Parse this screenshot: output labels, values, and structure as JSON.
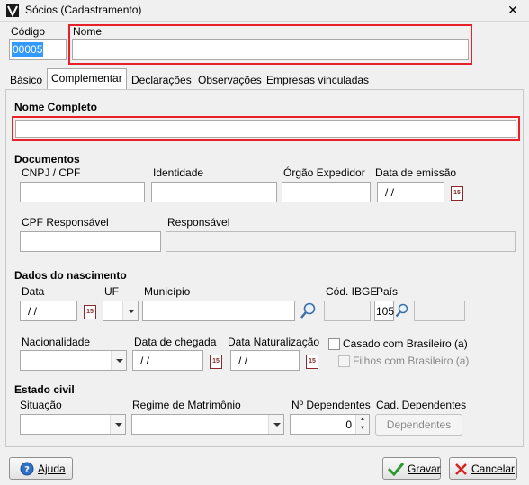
{
  "window": {
    "title": "Sócios (Cadastramento)",
    "close_glyph": "✕"
  },
  "header": {
    "codigo_label": "Código",
    "codigo_value": "00005",
    "nome_label": "Nome",
    "nome_value": ""
  },
  "tabs": [
    {
      "label": "Básico",
      "active": false
    },
    {
      "label": "Complementar",
      "active": true
    },
    {
      "label": "Declarações",
      "active": false
    },
    {
      "label": "Observações",
      "active": false
    },
    {
      "label": "Empresas vinculadas",
      "active": false
    }
  ],
  "nome_completo": {
    "label": "Nome Completo",
    "value": ""
  },
  "documentos": {
    "section_label": "Documentos",
    "cnpj_cpf_label": "CNPJ / CPF",
    "identidade_label": "Identidade",
    "orgao_label": "Órgão Expedidor",
    "data_emissao_label": "Data de emissão",
    "data_emissao_value": " /  /",
    "cpf_responsavel_label": "CPF Responsável",
    "responsavel_label": "Responsável"
  },
  "nascimento": {
    "section_label": "Dados do nascimento",
    "data_label": "Data",
    "data_value": " /  /",
    "uf_label": "UF",
    "municipio_label": "Município",
    "cod_ibge_label": "Cód. IBGE",
    "pais_label": "País",
    "pais_value": "105",
    "nacionalidade_label": "Nacionalidade",
    "data_chegada_label": "Data de chegada",
    "data_chegada_value": " /  /",
    "data_naturalizacao_label": "Data Naturalização",
    "data_naturalizacao_value": " /  /",
    "casado_label": "Casado com Brasileiro (a)",
    "filhos_label": "Filhos com Brasileiro (a)"
  },
  "estado_civil": {
    "section_label": "Estado civil",
    "situacao_label": "Situação",
    "regime_label": "Regime de Matrimônio",
    "n_dependentes_label": "Nº Dependentes",
    "n_dependentes_value": "0",
    "cad_dependentes_label": "Cad. Dependentes",
    "dependentes_button": "Dependentes"
  },
  "footer": {
    "ajuda_button": "Ajuda",
    "gravar_button": "Gravar",
    "cancelar_button": "Cancelar"
  },
  "icons": {
    "calendar_icon_text": "15",
    "accent_red": "#e8202a",
    "selection_blue": "#3399ff"
  }
}
